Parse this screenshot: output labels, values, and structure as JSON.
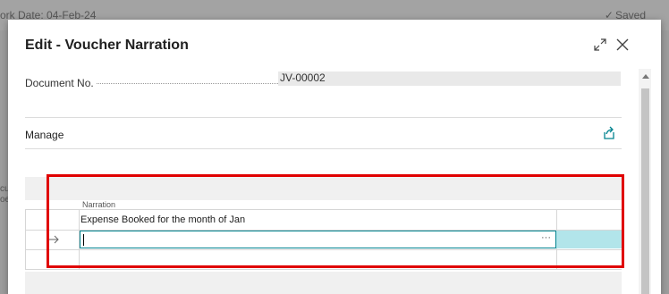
{
  "background": {
    "work_date": "ork Date: 04-Feb-24",
    "saved_label": "Saved",
    "left_fragment_1": "cu",
    "left_fragment_2": "oe"
  },
  "dialog": {
    "title": "Edit - Voucher Narration",
    "document_no_label": "Document No.",
    "document_no_value": "JV-00002",
    "manage_label": "Manage"
  },
  "grid": {
    "column_header": "Narration",
    "rows": [
      {
        "narration": "Expense Booked for the month of Jan"
      },
      {
        "narration": ""
      },
      {
        "narration": ""
      }
    ],
    "ellipsis": "···"
  },
  "colors": {
    "accent": "#00838f",
    "highlight_cell": "#b2e5ea",
    "annotation_border": "#e00000"
  }
}
